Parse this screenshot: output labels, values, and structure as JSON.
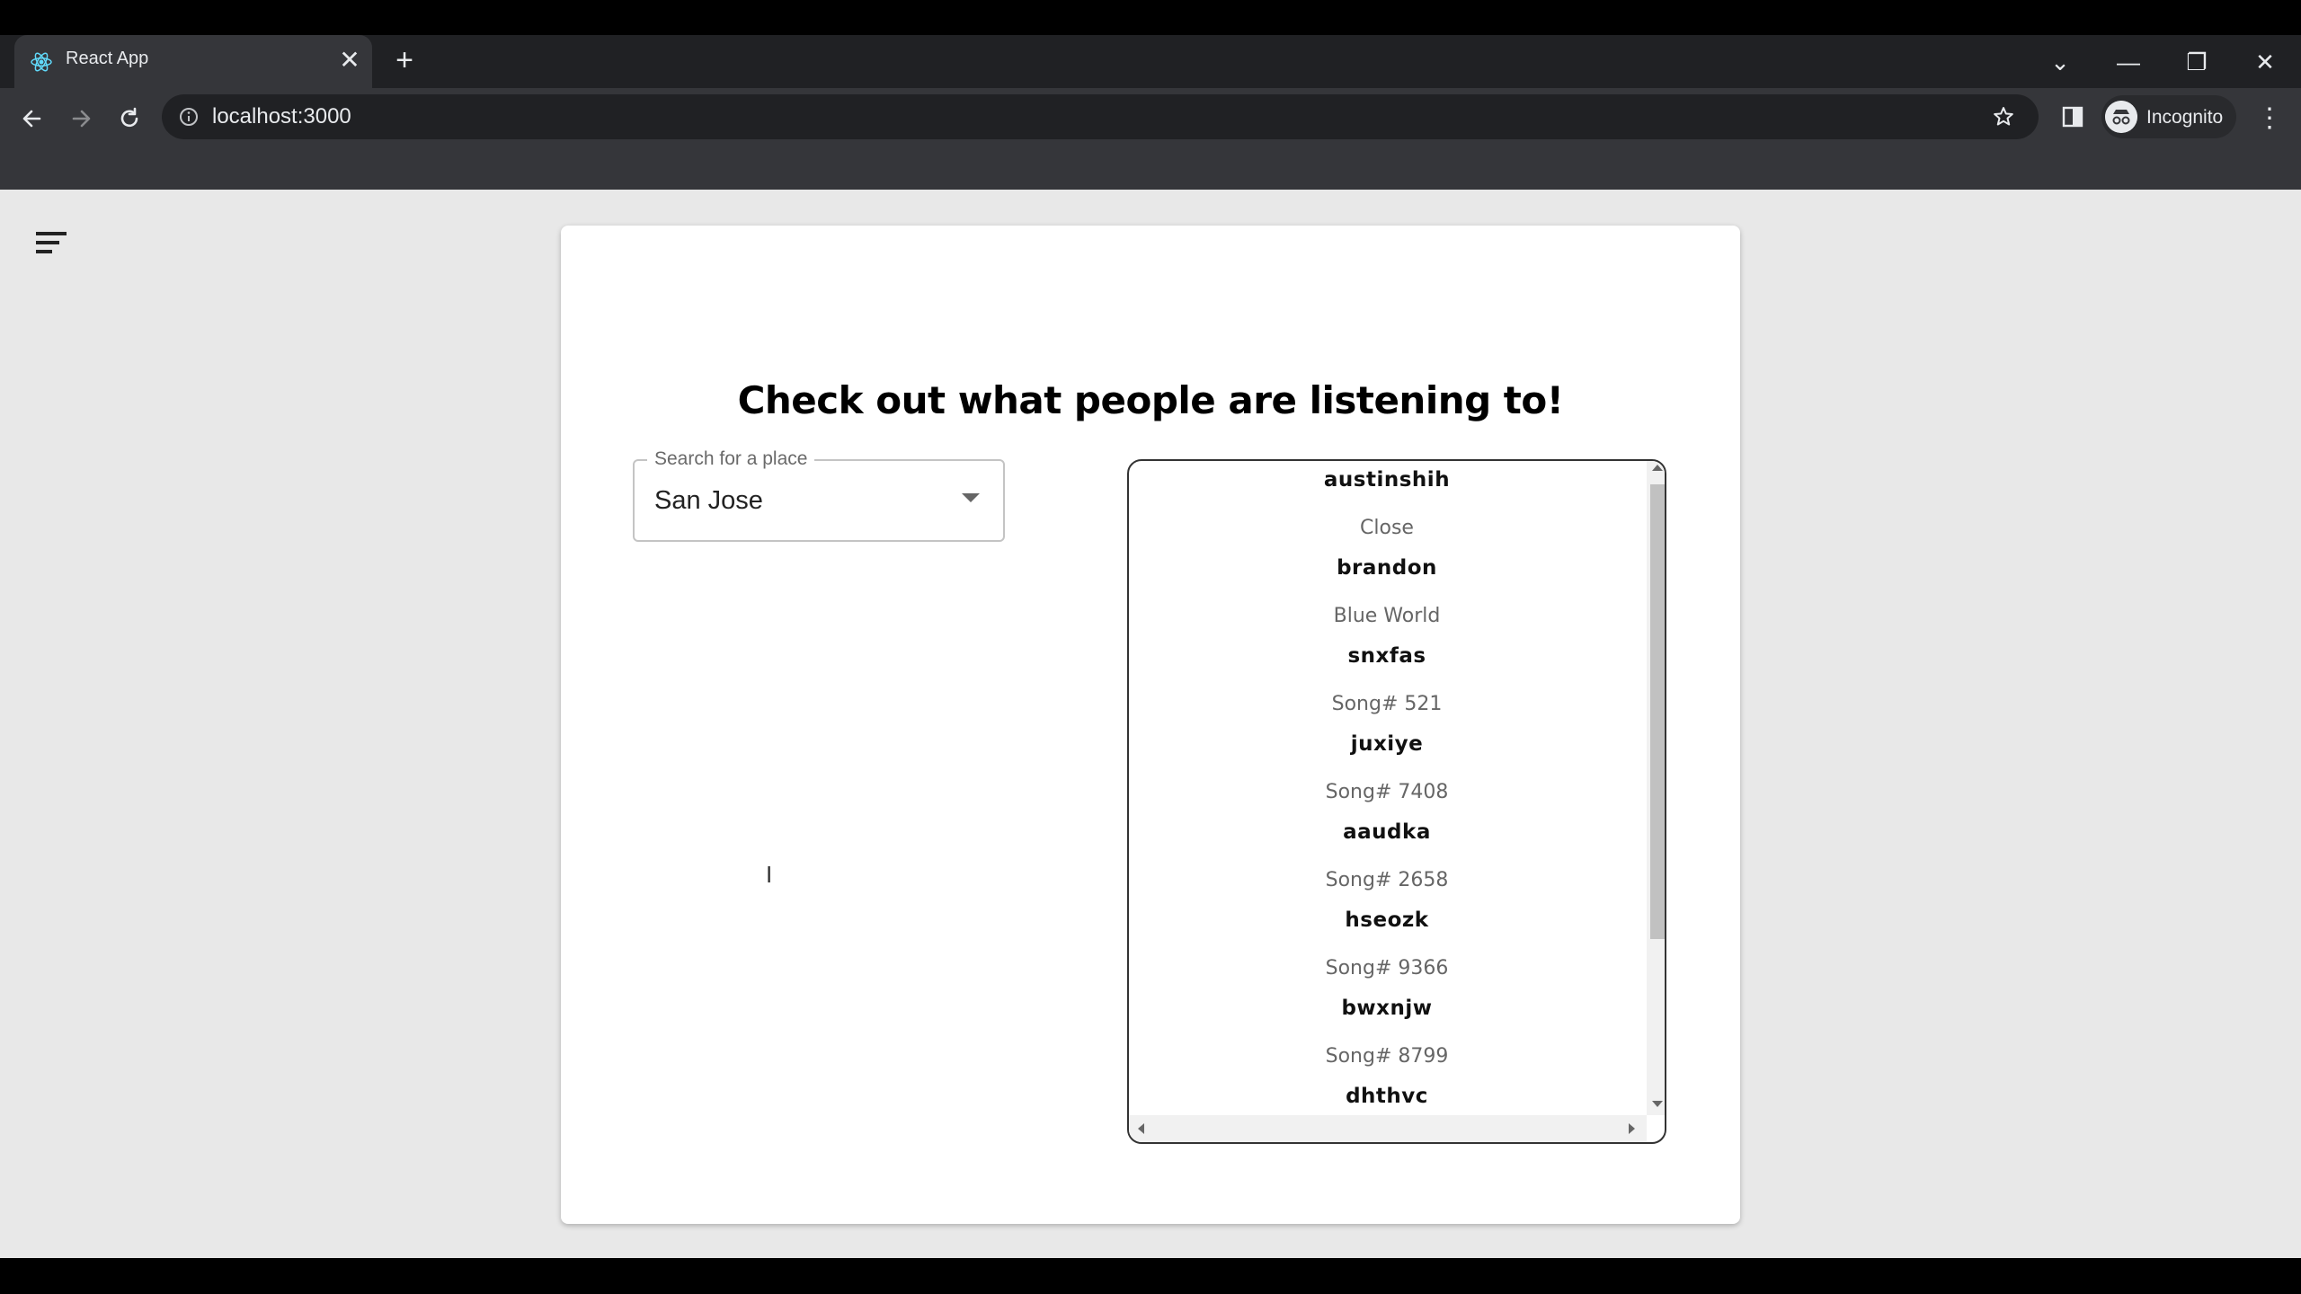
{
  "browser": {
    "tab_title": "React App",
    "tab_close": "✕",
    "new_tab": "+",
    "url": "localhost:3000",
    "profile_label": "Incognito",
    "menu": "⋮",
    "window_controls": {
      "dropdown": "⌄",
      "minimize": "—",
      "restore": "❐",
      "close": "✕"
    }
  },
  "page": {
    "heading": "Check out what people are listening to!",
    "place_select": {
      "legend": "Search for a place",
      "value": "San Jose"
    },
    "listening": [
      {
        "user": "austinshih",
        "song": "Close"
      },
      {
        "user": "brandon",
        "song": "Blue World"
      },
      {
        "user": "snxfas",
        "song": "Song# 521"
      },
      {
        "user": "juxiye",
        "song": "Song# 7408"
      },
      {
        "user": "aaudka",
        "song": "Song# 2658"
      },
      {
        "user": "hseozk",
        "song": "Song# 9366"
      },
      {
        "user": "bwxnjw",
        "song": "Song# 8799"
      },
      {
        "user": "dhthvc",
        "song": ""
      }
    ]
  },
  "colors": {
    "page_background": "#e8e8e8",
    "card_background": "#ffffff",
    "chrome_dark": "#202124",
    "chrome_toolbar": "#35363a"
  },
  "icons": [
    "react-favicon",
    "back-arrow-icon",
    "forward-arrow-icon",
    "reload-icon",
    "info-icon",
    "star-icon",
    "side-panel-icon",
    "incognito-icon",
    "hamburger-menu-icon",
    "dropdown-arrow-icon"
  ]
}
